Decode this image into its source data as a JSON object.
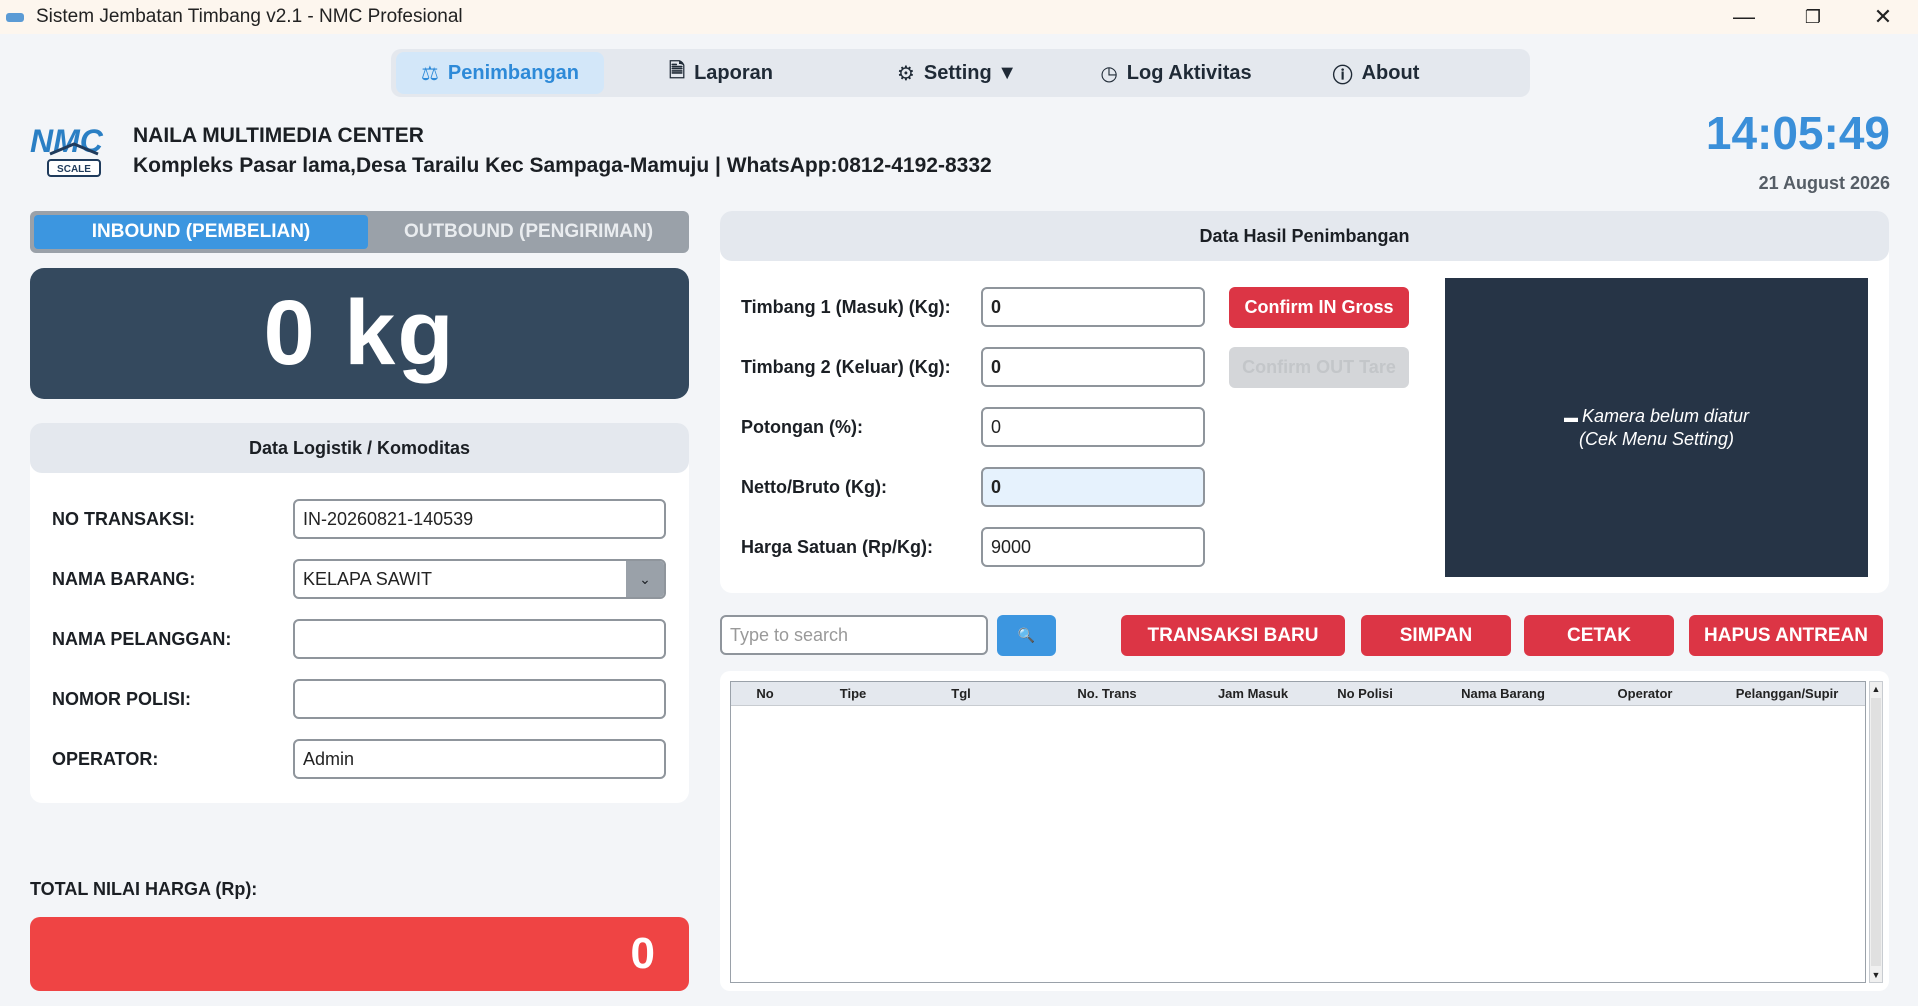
{
  "window": {
    "title": "Sistem Jembatan Timbang v2.1 - NMC Profesional",
    "minimize": "—",
    "maximize": "❐",
    "close": "✕"
  },
  "nav": [
    {
      "label": "Penimbangan",
      "icon": "scale-icon",
      "glyph": "⚖",
      "active": true
    },
    {
      "label": "Laporan",
      "icon": "document-icon",
      "glyph": "🗎"
    },
    {
      "label": "Setting ▼",
      "icon": "gear-icon",
      "glyph": "⚙"
    },
    {
      "label": "Log Aktivitas",
      "icon": "clock-icon",
      "glyph": "◷"
    },
    {
      "label": "About",
      "icon": "info-icon",
      "glyph": "ⓘ"
    }
  ],
  "header": {
    "logo_text": "NMC",
    "logo_sub": "SCALE",
    "company": "NAILA MULTIMEDIA CENTER",
    "address": "Kompleks Pasar lama,Desa Tarailu Kec Sampaga-Mamuju | WhatsApp:0812-4192-8332",
    "time": "14:05:49",
    "date": "21 August 2026"
  },
  "mode": {
    "inbound": "INBOUND (PEMBELIAN)",
    "outbound": "OUTBOUND (PENGIRIMAN)"
  },
  "weight_display": "0 kg",
  "logistics": {
    "title": "Data Logistik / Komoditas",
    "no_transaksi_label": "NO TRANSAKSI:",
    "no_transaksi_value": "IN-20260821-140539",
    "nama_barang_label": "NAMA BARANG:",
    "nama_barang_value": "KELAPA SAWIT",
    "nama_pelanggan_label": "NAMA PELANGGAN:",
    "nama_pelanggan_value": "",
    "nomor_polisi_label": "NOMOR POLISI:",
    "nomor_polisi_value": "",
    "operator_label": "OPERATOR:",
    "operator_value": "Admin"
  },
  "weighing": {
    "title": "Data Hasil Penimbangan",
    "timbang1_label": "Timbang 1 (Masuk) (Kg):",
    "timbang1_value": "0",
    "timbang2_label": "Timbang 2 (Keluar) (Kg):",
    "timbang2_value": "0",
    "potongan_label": "Potongan (%):",
    "potongan_value": "0",
    "netto_label": "Netto/Bruto (Kg):",
    "netto_value": "0",
    "harga_label": "Harga Satuan (Rp/Kg):",
    "harga_value": "9000",
    "confirm_in": "Confirm IN Gross",
    "confirm_out": "Confirm OUT Tare"
  },
  "camera": {
    "line1": "Kamera belum diatur",
    "line2": "(Cek Menu Setting)"
  },
  "actions": {
    "search_placeholder": "Type to search",
    "transaksi_baru": "TRANSAKSI BARU",
    "simpan": "SIMPAN",
    "cetak": "CETAK",
    "hapus_antrean": "HAPUS ANTREAN"
  },
  "table": {
    "columns": [
      "No",
      "Tipe",
      "Tgl",
      "No. Trans",
      "Jam Masuk",
      "No Polisi",
      "Nama Barang",
      "Operator",
      "Pelanggan/Supir"
    ],
    "rows": []
  },
  "total": {
    "label": "TOTAL NILAI HARGA (Rp):",
    "value": "0"
  },
  "colors": {
    "accent": "#3c96e0",
    "danger": "#dc3545",
    "dark": "#34495e",
    "total": "#ef4444"
  }
}
